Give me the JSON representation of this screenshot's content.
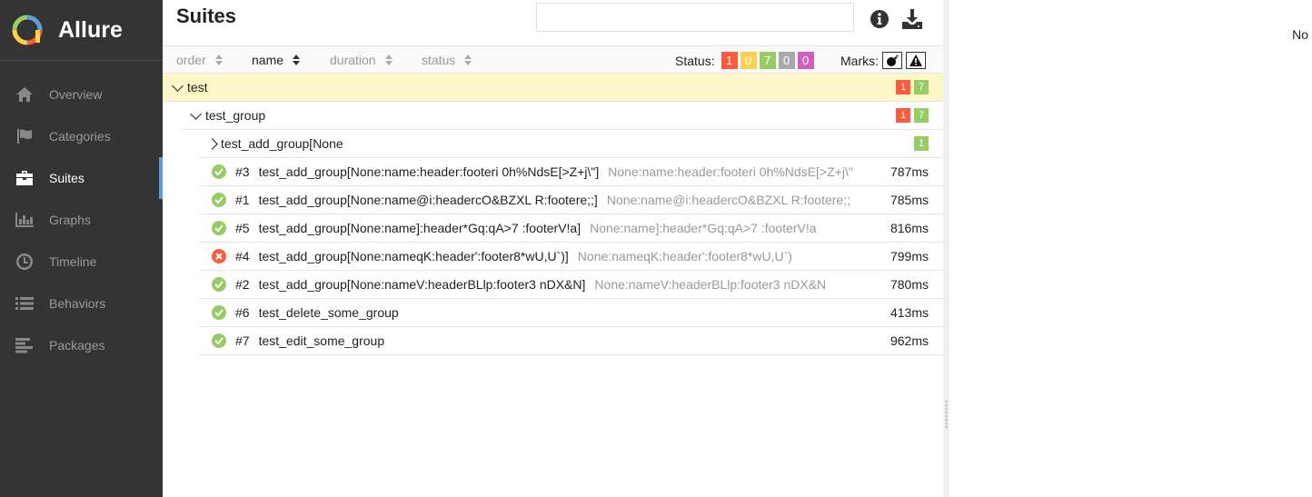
{
  "app": {
    "name": "Allure"
  },
  "sidebar": {
    "items": [
      {
        "label": "Overview",
        "icon": "home-icon",
        "active": false
      },
      {
        "label": "Categories",
        "icon": "flag-icon",
        "active": false
      },
      {
        "label": "Suites",
        "icon": "briefcase-icon",
        "active": true
      },
      {
        "label": "Graphs",
        "icon": "bar-chart-icon",
        "active": false
      },
      {
        "label": "Timeline",
        "icon": "clock-icon",
        "active": false
      },
      {
        "label": "Behaviors",
        "icon": "list-icon",
        "active": false
      },
      {
        "label": "Packages",
        "icon": "align-left-icon",
        "active": false
      }
    ]
  },
  "pane": {
    "title": "Suites",
    "search": {
      "value": "",
      "placeholder": ""
    },
    "sort": [
      {
        "label": "order",
        "active": false
      },
      {
        "label": "name",
        "active": true
      },
      {
        "label": "duration",
        "active": false
      },
      {
        "label": "status",
        "active": false
      }
    ],
    "status_filter": {
      "label": "Status:",
      "chips": [
        {
          "value": "1",
          "color": "#fd5a3e",
          "status": "failed"
        },
        {
          "value": "0",
          "color": "#ffd050",
          "status": "broken"
        },
        {
          "value": "7",
          "color": "#97cc64",
          "status": "passed"
        },
        {
          "value": "0",
          "color": "#aaaaaa",
          "status": "skipped"
        },
        {
          "value": "0",
          "color": "#d35ebe",
          "status": "unknown"
        }
      ]
    },
    "marks": {
      "label": "Marks:",
      "items": [
        "flaky-icon",
        "warning-icon"
      ]
    }
  },
  "tree": {
    "suite": {
      "name": "test",
      "failed": "1",
      "passed": "7"
    },
    "group": {
      "name": "test_group",
      "failed": "1",
      "passed": "7"
    },
    "subgroup": {
      "name": "test_add_group[None",
      "passed": "1"
    },
    "cases": [
      {
        "status": "passed",
        "num": "#3",
        "name": "test_add_group[None:name:header:footeri 0h%NdsE[>Z+j\\\"]",
        "params": "None:name:header:footeri 0h%NdsE[>Z+j\\\"",
        "duration": "787ms"
      },
      {
        "status": "passed",
        "num": "#1",
        "name": "test_add_group[None:name@i:headercO&BZXL R:footere;;]",
        "params": "None:name@i:headercO&BZXL R:footere;;",
        "duration": "785ms"
      },
      {
        "status": "passed",
        "num": "#5",
        "name": "test_add_group[None:name]:header*Gq:qA>7 :footerV!a]",
        "params": "None:name]:header*Gq:qA>7 :footerV!a",
        "duration": "816ms"
      },
      {
        "status": "failed",
        "num": "#4",
        "name": "test_add_group[None:nameqK:header':footer8*wU,U`)]",
        "params": "None:nameqK:header':footer8*wU,U`)",
        "duration": "799ms"
      },
      {
        "status": "passed",
        "num": "#2",
        "name": "test_add_group[None:nameV:headerBLlp:footer3 nDX&N]",
        "params": "None:nameV:headerBLlp:footer3 nDX&N",
        "duration": "780ms"
      },
      {
        "status": "passed",
        "num": "#6",
        "name": "test_delete_some_group",
        "params": "",
        "duration": "413ms"
      },
      {
        "status": "passed",
        "num": "#7",
        "name": "test_edit_some_group",
        "params": "",
        "duration": "962ms"
      }
    ]
  },
  "right_pane": {
    "text": "No"
  },
  "colors": {
    "sidebar_bg": "#343434",
    "accent": "#5c9fd6",
    "failed": "#fd5a3e",
    "passed": "#97cc64",
    "highlight": "#fdf7c8"
  }
}
